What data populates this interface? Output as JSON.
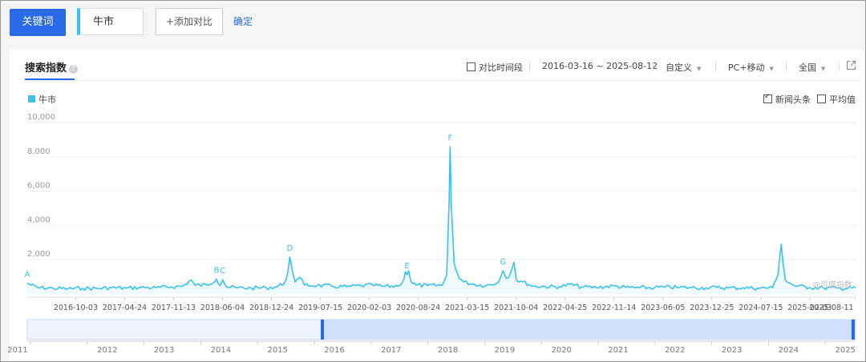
{
  "toolbar": {
    "keyword_btn": "关键词",
    "keyword_value": "牛市",
    "add_compare": "+添加对比",
    "confirm": "确定"
  },
  "panel": {
    "title": "搜索指数",
    "help_icon": "?",
    "compare_period": "对比时间段",
    "date_range": "2016-03-16 ~ 2025-08-12",
    "custom": "自定义",
    "device": "PC+移动",
    "region": "全国",
    "share_icon": "external-link-icon"
  },
  "legend": {
    "series": "牛市",
    "color": "#39c2f0"
  },
  "options": {
    "news": "新闻头条",
    "news_checked": true,
    "average": "平均值",
    "average_checked": false
  },
  "watermark": "@百度指数",
  "chart_data": {
    "type": "line",
    "ylim": [
      0,
      10000
    ],
    "yticks": [
      "10,000",
      "8,000",
      "6,000",
      "4,000",
      "2,000"
    ],
    "xticks": [
      "2016-10-03",
      "2017-04-24",
      "2017-11-13",
      "2018-06-04",
      "2018-12-24",
      "2019-07-15",
      "2020-02-03",
      "2020-08-24",
      "2021-03-15",
      "2021-10-04",
      "2022-04-25",
      "2022-11-14",
      "2023-06-05",
      "2023-12-25",
      "2024-07-15",
      "2025-02-03",
      "2025-08-11"
    ],
    "x_start": "2016-03-16",
    "x_end": "2025-08-12",
    "series": [
      {
        "name": "牛市",
        "points": [
          [
            "2016-03-16",
            620
          ],
          [
            "2016-05-01",
            360
          ],
          [
            "2016-07-01",
            330
          ],
          [
            "2016-09-01",
            300
          ],
          [
            "2016-11-01",
            330
          ],
          [
            "2017-01-01",
            320
          ],
          [
            "2017-03-01",
            360
          ],
          [
            "2017-05-01",
            340
          ],
          [
            "2017-07-01",
            380
          ],
          [
            "2017-09-01",
            360
          ],
          [
            "2017-11-01",
            410
          ],
          [
            "2017-12-20",
            450
          ],
          [
            "2018-01-25",
            820
          ],
          [
            "2018-02-10",
            500
          ],
          [
            "2018-04-01",
            520
          ],
          [
            "2018-05-10",
            860
          ],
          [
            "2018-05-25",
            480
          ],
          [
            "2018-06-05",
            830
          ],
          [
            "2018-06-20",
            420
          ],
          [
            "2018-08-01",
            360
          ],
          [
            "2018-10-01",
            340
          ],
          [
            "2018-12-01",
            360
          ],
          [
            "2019-01-15",
            420
          ],
          [
            "2019-02-15",
            620
          ],
          [
            "2019-03-01",
            1200
          ],
          [
            "2019-03-10",
            2150
          ],
          [
            "2019-03-20",
            1400
          ],
          [
            "2019-04-01",
            700
          ],
          [
            "2019-04-20",
            950
          ],
          [
            "2019-05-10",
            520
          ],
          [
            "2019-07-01",
            500
          ],
          [
            "2019-09-01",
            440
          ],
          [
            "2019-11-01",
            420
          ],
          [
            "2020-01-01",
            480
          ],
          [
            "2020-02-15",
            520
          ],
          [
            "2020-04-01",
            440
          ],
          [
            "2020-06-01",
            460
          ],
          [
            "2020-06-25",
            820
          ],
          [
            "2020-07-01",
            1300
          ],
          [
            "2020-07-08",
            1120
          ],
          [
            "2020-07-15",
            1350
          ],
          [
            "2020-07-25",
            700
          ],
          [
            "2020-08-15",
            520
          ],
          [
            "2020-10-01",
            480
          ],
          [
            "2020-12-01",
            500
          ],
          [
            "2020-12-20",
            1100
          ],
          [
            "2020-12-30",
            5400
          ],
          [
            "2021-01-03",
            8600
          ],
          [
            "2021-01-08",
            5200
          ],
          [
            "2021-01-20",
            1800
          ],
          [
            "2021-02-10",
            900
          ],
          [
            "2021-03-01",
            700
          ],
          [
            "2021-04-15",
            550
          ],
          [
            "2021-06-01",
            500
          ],
          [
            "2021-07-15",
            620
          ],
          [
            "2021-08-01",
            1000
          ],
          [
            "2021-08-10",
            1350
          ],
          [
            "2021-08-25",
            900
          ],
          [
            "2021-09-10",
            1200
          ],
          [
            "2021-09-25",
            1850
          ],
          [
            "2021-10-05",
            800
          ],
          [
            "2021-11-01",
            700
          ],
          [
            "2021-12-15",
            450
          ],
          [
            "2022-02-01",
            430
          ],
          [
            "2022-04-01",
            420
          ],
          [
            "2022-05-15",
            560
          ],
          [
            "2022-07-01",
            400
          ],
          [
            "2022-09-01",
            380
          ],
          [
            "2022-11-10",
            470
          ],
          [
            "2023-01-01",
            380
          ],
          [
            "2023-03-01",
            360
          ],
          [
            "2023-05-01",
            370
          ],
          [
            "2023-06-15",
            400
          ],
          [
            "2023-08-01",
            380
          ],
          [
            "2023-10-01",
            370
          ],
          [
            "2023-12-01",
            360
          ],
          [
            "2024-01-15",
            380
          ],
          [
            "2024-03-01",
            350
          ],
          [
            "2024-05-01",
            360
          ],
          [
            "2024-07-01",
            340
          ],
          [
            "2024-09-01",
            360
          ],
          [
            "2024-09-25",
            1200
          ],
          [
            "2024-10-03",
            2400
          ],
          [
            "2024-10-08",
            2900
          ],
          [
            "2024-10-15",
            1800
          ],
          [
            "2024-10-25",
            800
          ],
          [
            "2024-12-01",
            480
          ],
          [
            "2025-02-01",
            380
          ],
          [
            "2025-04-01",
            350
          ],
          [
            "2025-06-01",
            330
          ],
          [
            "2025-08-12",
            340
          ]
        ]
      }
    ],
    "annotations": [
      {
        "label": "A",
        "date": "2016-03-16",
        "value": 620
      },
      {
        "label": "B",
        "date": "2018-05-10",
        "value": 860
      },
      {
        "label": "C",
        "date": "2018-06-05",
        "value": 830
      },
      {
        "label": "D",
        "date": "2019-03-10",
        "value": 2150
      },
      {
        "label": "E",
        "date": "2020-07-08",
        "value": 1120
      },
      {
        "label": "F",
        "date": "2021-01-03",
        "value": 8600
      },
      {
        "label": "G",
        "date": "2021-08-10",
        "value": 1350
      }
    ],
    "range_years": [
      "2011",
      "2012",
      "2013",
      "2014",
      "2015",
      "2016",
      "2017",
      "2018",
      "2019",
      "2020",
      "2021",
      "2022",
      "2023",
      "2024",
      "2025"
    ]
  }
}
